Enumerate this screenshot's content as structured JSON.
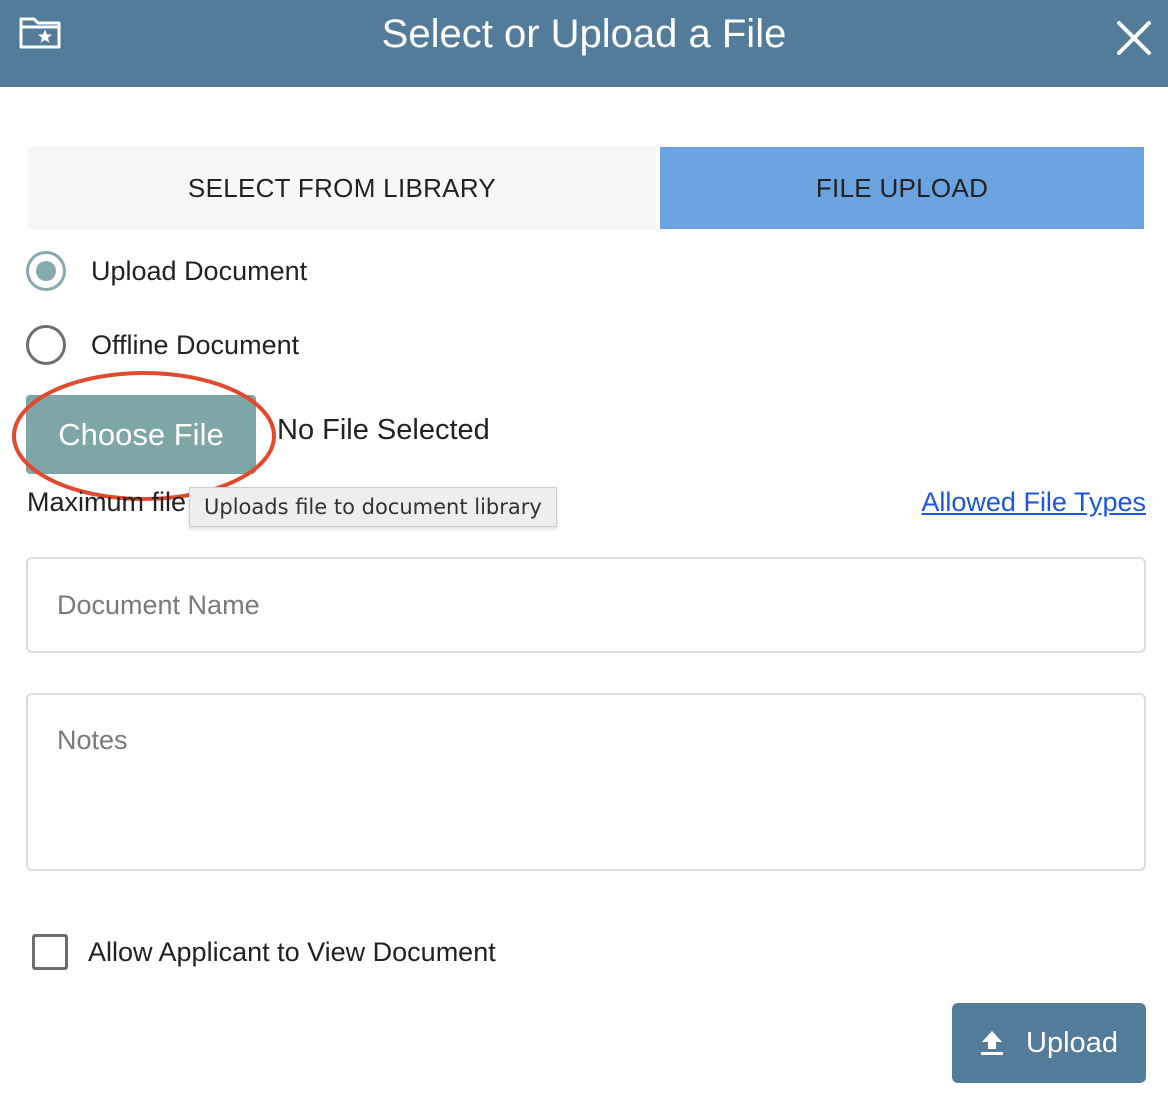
{
  "dialog": {
    "title": "Select or Upload a File",
    "header_icon": "folder-star-icon",
    "close_icon": "close-icon",
    "colors": {
      "header": "#527c9a",
      "active_tab": "#6aa3e0",
      "choose_file_button": "#7fa6a6",
      "highlight_ellipse": "#e04a2f",
      "link": "#1a56e0"
    }
  },
  "tabs": [
    {
      "label": "SELECT FROM LIBRARY",
      "active": false
    },
    {
      "label": "FILE UPLOAD",
      "active": true
    }
  ],
  "document_type": {
    "options": [
      {
        "label": "Upload Document",
        "checked": true
      },
      {
        "label": "Offline Document",
        "checked": false
      }
    ]
  },
  "file_picker": {
    "button_label": "Choose File",
    "status": "No File Selected",
    "tooltip": "Uploads file to document library"
  },
  "max_file_label": "Maximum file",
  "allowed_types_link": "Allowed File Types",
  "fields": {
    "document_name_placeholder": "Document Name",
    "notes_placeholder": "Notes"
  },
  "allow_view": {
    "label": "Allow Applicant to View Document",
    "checked": false
  },
  "upload_button": {
    "label": "Upload",
    "icon": "upload-icon"
  }
}
